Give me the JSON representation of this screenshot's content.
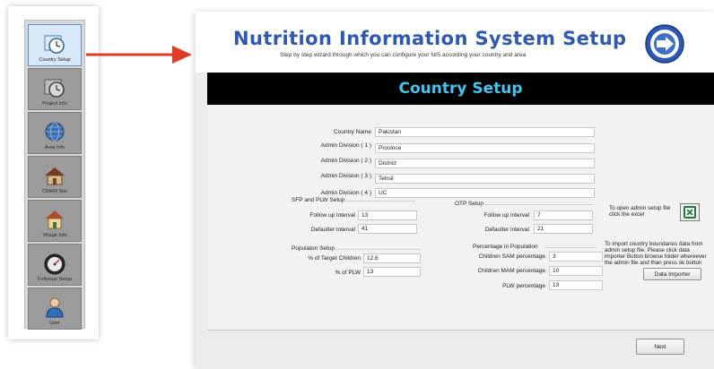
{
  "app": {
    "title": "Nutrition Information System Setup",
    "subtitle": "Step by step wizard through which you can configure your NIS according your country and area"
  },
  "colors": {
    "title": "#2d59b5",
    "banner_bg": "#000000",
    "banner_text": "#3ec8f1",
    "arrow": "#e23b24"
  },
  "sidebar": {
    "items": [
      {
        "label": "Country Setup",
        "icon": "clock-icon",
        "active": true
      },
      {
        "label": "Project info",
        "icon": "clock-icon"
      },
      {
        "label": "Area Info",
        "icon": "globe-icon"
      },
      {
        "label": "CMAM Site",
        "icon": "house-icon"
      },
      {
        "label": "Village Info",
        "icon": "village-icon"
      },
      {
        "label": "Followup Setup",
        "icon": "gauge-icon"
      },
      {
        "label": "User",
        "icon": "user-icon"
      }
    ]
  },
  "page": {
    "heading": "Country Setup"
  },
  "country": {
    "name_label": "Country Name",
    "name_value": "Pakistan",
    "admin1_label": "Admin Division ( 1 )",
    "admin1_value": "Province",
    "admin2_label": "Admin Division ( 2 )",
    "admin2_value": "District",
    "admin3_label": "Admin Division ( 3 )",
    "admin3_value": "Tehsil",
    "admin4_label": "Admin Division ( 4 )",
    "admin4_value": "UC"
  },
  "sfp": {
    "title": "SFP and PLW Setup",
    "followup_label": "Follow up interval",
    "followup_value": "13",
    "defaulter_label": "Defaulter interval",
    "defaulter_value": "41"
  },
  "otp": {
    "title": "OTP Setup",
    "followup_label": "Follow up interval",
    "followup_value": "7",
    "defaulter_label": "Defaulter interval",
    "defaulter_value": "21"
  },
  "population": {
    "title": "Populaton Setup",
    "target_children_label": "% of Target Children",
    "target_children_value": "12.6",
    "plw_label": "% of PLW",
    "plw_value": "13"
  },
  "percentage": {
    "title": "Percentage in Population",
    "sam_label": "Children SAM percentage",
    "sam_value": "3",
    "mam_label": "Children MAM  percentage",
    "mam_value": "10",
    "plw_label": "PLW percentage",
    "plw_value": "13"
  },
  "admin_setup": {
    "excel_text": "To open admin setup file click the excel",
    "importer_text": "To import country boundaries data from admin setup file.  Please click data importer Button browse folder whereever the admin file and than press ok button",
    "importer_button": "Data Importer"
  },
  "footer": {
    "next_button": "Next"
  }
}
